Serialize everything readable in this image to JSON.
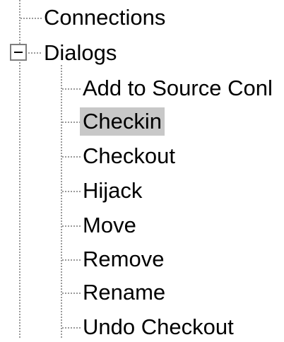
{
  "tree": {
    "root_items": [
      {
        "label": "Connections"
      },
      {
        "label": "Dialogs",
        "expanded": true
      }
    ],
    "dialogs_children": [
      {
        "label": "Add to Source Conl"
      },
      {
        "label": "Checkin",
        "selected": true
      },
      {
        "label": "Checkout"
      },
      {
        "label": "Hijack"
      },
      {
        "label": "Move"
      },
      {
        "label": "Remove"
      },
      {
        "label": "Rename"
      },
      {
        "label": "Undo Checkout"
      }
    ],
    "expander_icon": "collapse-minus-icon"
  }
}
